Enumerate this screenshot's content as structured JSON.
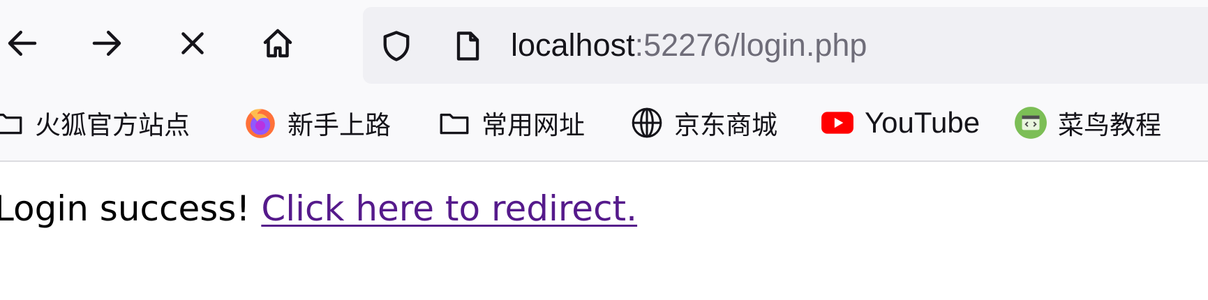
{
  "navigation": {
    "back_icon": "arrow-left-icon",
    "forward_icon": "arrow-right-icon",
    "stop_icon": "close-icon",
    "home_icon": "home-icon"
  },
  "urlbar": {
    "security_icon": "shield-icon",
    "page_icon": "page-icon",
    "host": "localhost",
    "rest": ":52276/login.php"
  },
  "bookmarks": [
    {
      "label": "火狐官方站点",
      "icon": "folder-icon"
    },
    {
      "label": "新手上路",
      "icon": "firefox-icon"
    },
    {
      "label": "常用网址",
      "icon": "folder-icon"
    },
    {
      "label": "京东商城",
      "icon": "globe-icon"
    },
    {
      "label": "YouTube",
      "icon": "youtube-icon"
    },
    {
      "label": "菜鸟教程",
      "icon": "runoob-icon"
    }
  ],
  "page": {
    "message": "Login success! ",
    "link_text": "Click here to redirect."
  },
  "colors": {
    "toolbar_bg": "#f9f9fb",
    "urlbar_bg": "#f0f0f4",
    "visited_link": "#551a8b",
    "youtube_red": "#ff0000",
    "runoob_green": "#7cbe56"
  }
}
